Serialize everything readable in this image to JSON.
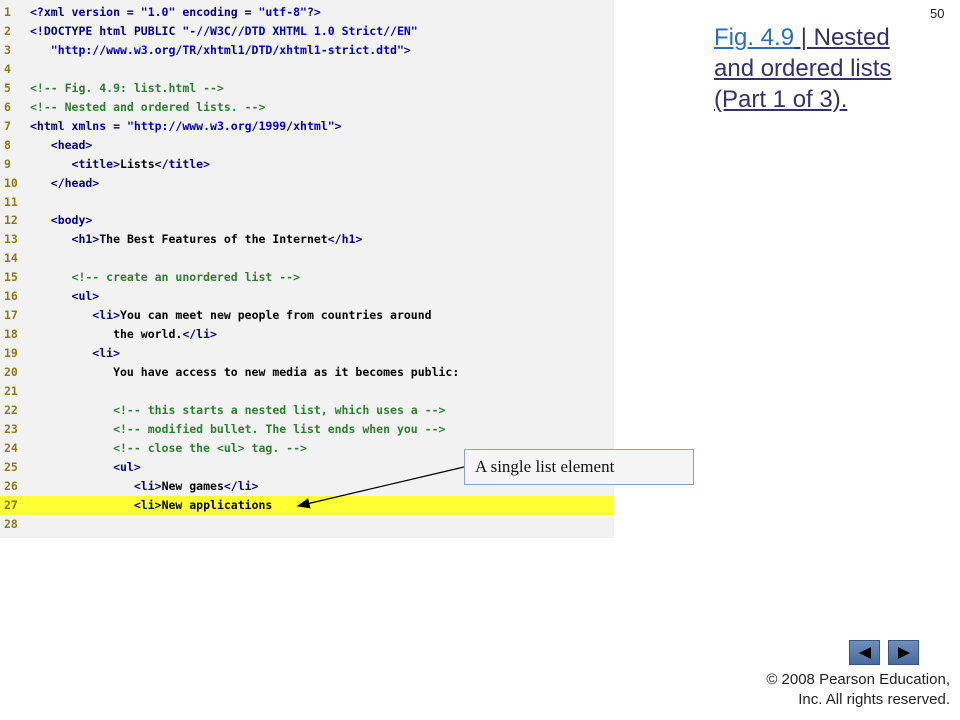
{
  "page_number": "50",
  "title": {
    "fig_link": "Fig. 4.9",
    "rest": " | Nested and ordered lists (Part 1 of 3)."
  },
  "callout": "A single list element",
  "copyright": {
    "line1": "© 2008 Pearson Education,",
    "line2": "Inc.  All rights reserved."
  },
  "nav": {
    "prev_label": "◀",
    "next_label": "▶"
  },
  "code_lines": [
    {
      "n": "1",
      "segs": [
        [
          "t",
          "<?xml version = "
        ],
        [
          "s",
          "\"1.0\""
        ],
        [
          "t",
          " encoding = "
        ],
        [
          "s",
          "\"utf-8\""
        ],
        [
          "t",
          "?>"
        ]
      ]
    },
    {
      "n": "2",
      "segs": [
        [
          "t",
          "<!DOCTYPE html PUBLIC "
        ],
        [
          "s",
          "\"-//W3C//DTD XHTML 1.0 Strict//EN\""
        ]
      ]
    },
    {
      "n": "3",
      "segs": [
        [
          "s",
          "   \"http://www.w3.org/TR/xhtml1/DTD/xhtml1-strict.dtd\""
        ],
        [
          "t",
          ">"
        ]
      ]
    },
    {
      "n": "4",
      "segs": []
    },
    {
      "n": "5",
      "segs": [
        [
          "c",
          "<!-- Fig. 4.9: list.html -->"
        ]
      ]
    },
    {
      "n": "6",
      "segs": [
        [
          "c",
          "<!-- Nested and ordered lists. -->"
        ]
      ]
    },
    {
      "n": "7",
      "segs": [
        [
          "t",
          "<html xmlns = "
        ],
        [
          "s",
          "\"http://www.w3.org/1999/xhtml\""
        ],
        [
          "t",
          ">"
        ]
      ]
    },
    {
      "n": "8",
      "segs": [
        [
          "t",
          "   <head>"
        ]
      ]
    },
    {
      "n": "9",
      "segs": [
        [
          "t",
          "      <title>"
        ],
        [
          "x",
          "Lists"
        ],
        [
          "t",
          "</title>"
        ]
      ]
    },
    {
      "n": "10",
      "segs": [
        [
          "t",
          "   </head>"
        ]
      ]
    },
    {
      "n": "11",
      "segs": []
    },
    {
      "n": "12",
      "segs": [
        [
          "t",
          "   <body>"
        ]
      ]
    },
    {
      "n": "13",
      "segs": [
        [
          "t",
          "      <h1>"
        ],
        [
          "x",
          "The Best Features of the Internet"
        ],
        [
          "t",
          "</h1>"
        ]
      ]
    },
    {
      "n": "14",
      "segs": []
    },
    {
      "n": "15",
      "segs": [
        [
          "c",
          "      <!-- create an unordered list -->"
        ]
      ]
    },
    {
      "n": "16",
      "segs": [
        [
          "t",
          "      <ul>"
        ]
      ]
    },
    {
      "n": "17",
      "segs": [
        [
          "t",
          "         <li>"
        ],
        [
          "x",
          "You can meet new people from countries around"
        ]
      ]
    },
    {
      "n": "18",
      "segs": [
        [
          "x",
          "            the world."
        ],
        [
          "t",
          "</li>"
        ]
      ]
    },
    {
      "n": "19",
      "segs": [
        [
          "t",
          "         <li>"
        ]
      ]
    },
    {
      "n": "20",
      "segs": [
        [
          "x",
          "            You have access to new media as it becomes public:"
        ]
      ]
    },
    {
      "n": "21",
      "segs": []
    },
    {
      "n": "22",
      "segs": [
        [
          "c",
          "            <!-- this starts a nested list, which uses a -->"
        ]
      ]
    },
    {
      "n": "23",
      "segs": [
        [
          "c",
          "            <!-- modified bullet. The list ends when you -->"
        ]
      ]
    },
    {
      "n": "24",
      "segs": [
        [
          "c",
          "            <!-- close the <ul> tag. -->"
        ]
      ]
    },
    {
      "n": "25",
      "segs": [
        [
          "t",
          "            <ul>"
        ]
      ]
    },
    {
      "n": "26",
      "segs": [
        [
          "t",
          "               <li>"
        ],
        [
          "x",
          "New games"
        ],
        [
          "t",
          "</li>"
        ]
      ]
    },
    {
      "n": "27",
      "segs": [
        [
          "t",
          "               <li>"
        ],
        [
          "x",
          "New applications"
        ]
      ],
      "highlight": true
    },
    {
      "n": "28",
      "segs": []
    }
  ],
  "colors": {
    "panel_bg": "#f2f2f2",
    "highlight": "#ffff33",
    "title": "#333366",
    "link": "#2f6fb0"
  }
}
